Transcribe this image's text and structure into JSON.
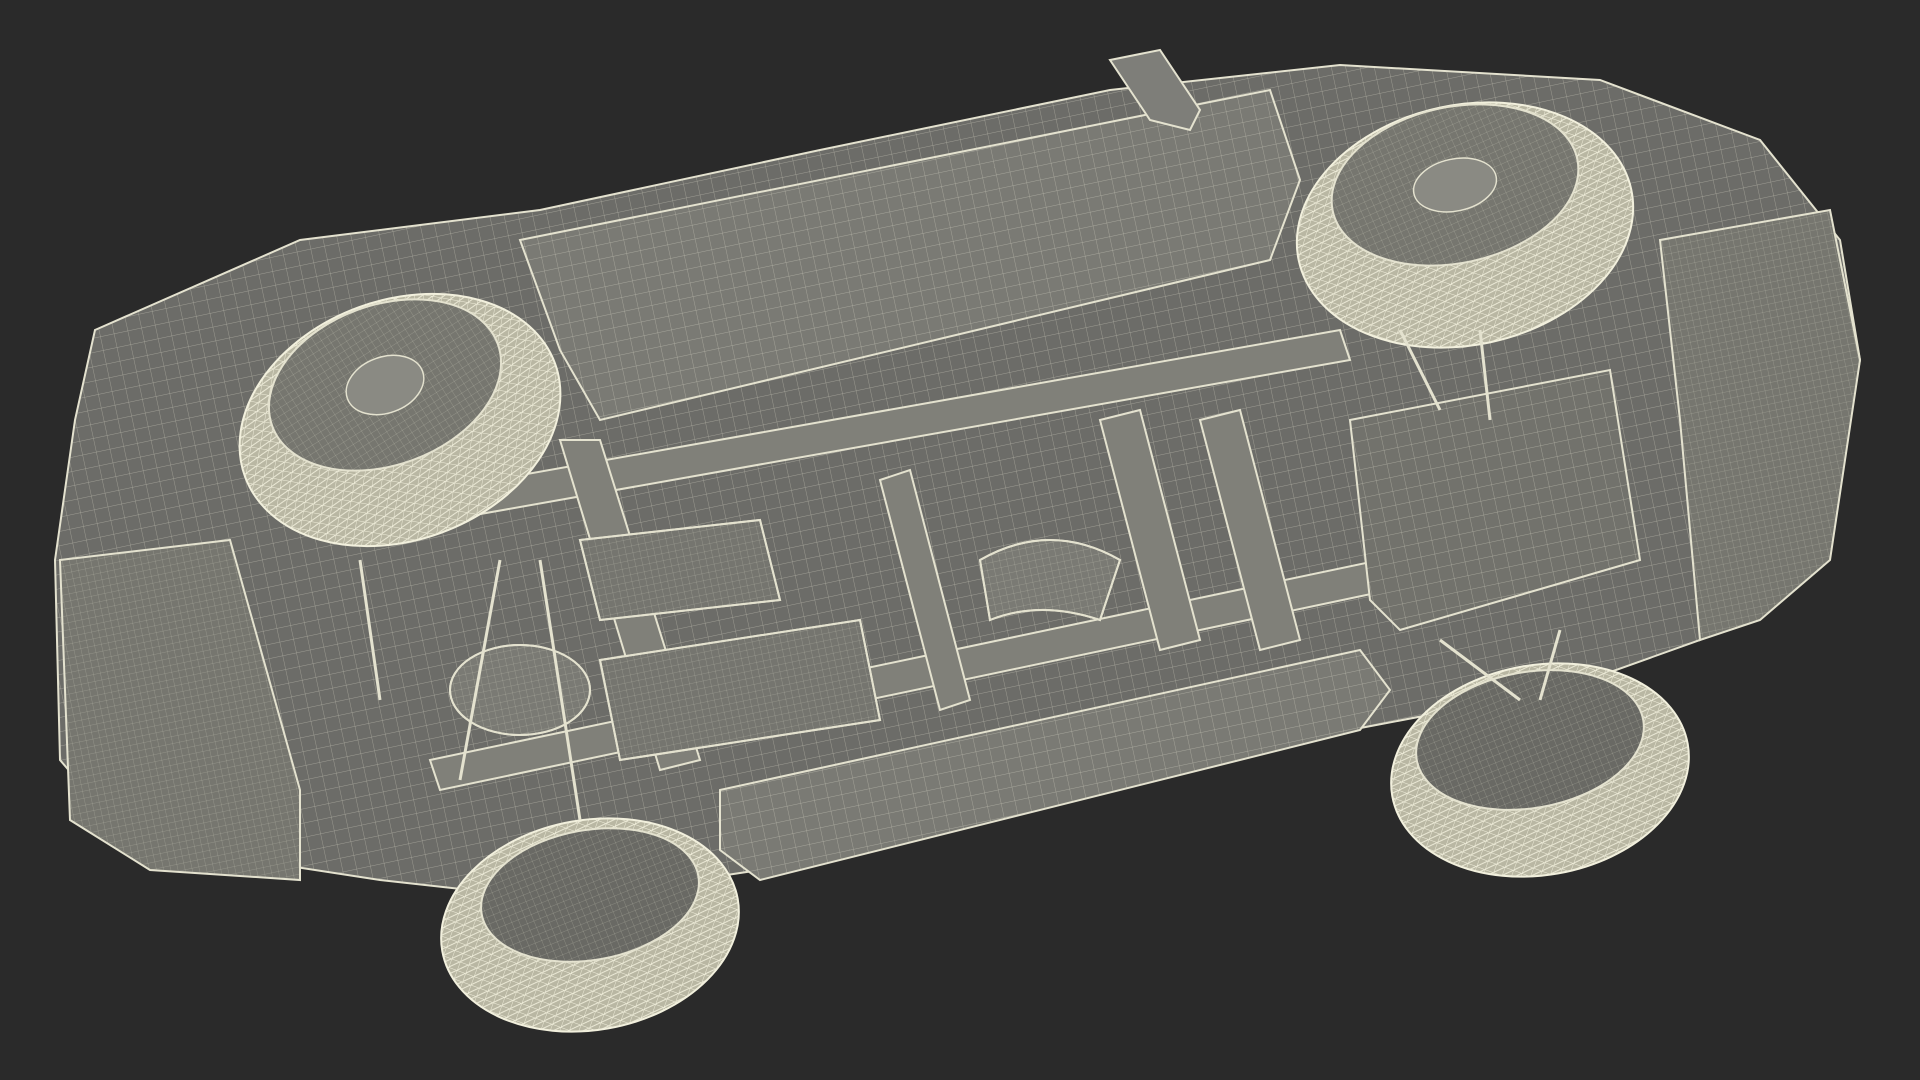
{
  "scene": {
    "subject": "vehicle-underside-wireframe",
    "colors": {
      "background": "#2a2a2a",
      "body_fill": "#6c6c68",
      "body_shadow": "#545450",
      "body_light": "#7e7e79",
      "wire": "#e4e2cf",
      "wire_dim": "#c9c7b4",
      "tire": "#c8c6b2",
      "tire_tread": "#eeecd9",
      "frame": "#808079"
    }
  }
}
